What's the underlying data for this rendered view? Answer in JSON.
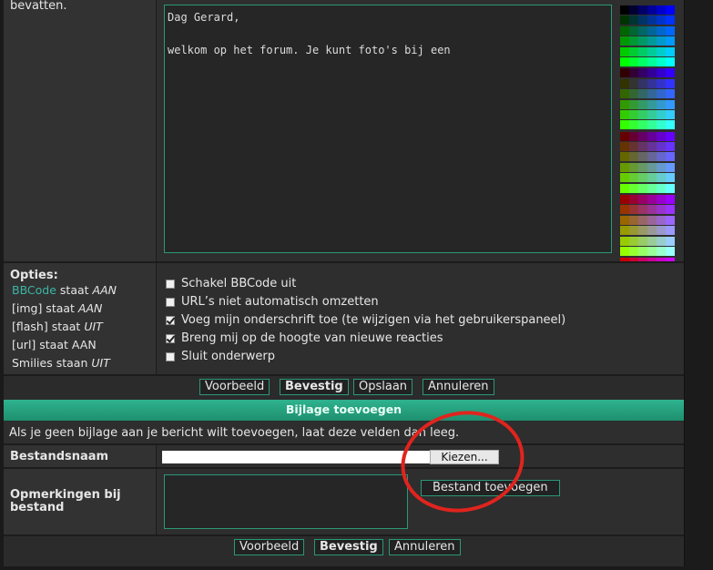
{
  "top_left_text": "bevatten.",
  "message": {
    "text": "Dag Gerard,\n\nwelkom op het forum. Je kunt foto's bij een"
  },
  "palette": {
    "rows": [
      [
        "#000000",
        "#000033",
        "#000066",
        "#000099",
        "#0000cc",
        "#0000ff"
      ],
      [
        "#003300",
        "#003333",
        "#003366",
        "#003399",
        "#0033cc",
        "#0033ff"
      ],
      [
        "#006600",
        "#006633",
        "#006666",
        "#006699",
        "#0066cc",
        "#0066ff"
      ],
      [
        "#009900",
        "#009933",
        "#009966",
        "#009999",
        "#0099cc",
        "#0099ff"
      ],
      [
        "#00cc00",
        "#00cc33",
        "#00cc66",
        "#00cc99",
        "#00cccc",
        "#00ccff"
      ],
      [
        "#00ff00",
        "#00ff33",
        "#00ff66",
        "#00ff99",
        "#00ffcc",
        "#00ffff"
      ],
      [
        "#330000",
        "#330033",
        "#330066",
        "#330099",
        "#3300cc",
        "#3300ff"
      ],
      [
        "#333300",
        "#333333",
        "#333366",
        "#333399",
        "#3333cc",
        "#3333ff"
      ],
      [
        "#336600",
        "#336633",
        "#336666",
        "#336699",
        "#3366cc",
        "#3366ff"
      ],
      [
        "#339900",
        "#339933",
        "#339966",
        "#339999",
        "#3399cc",
        "#3399ff"
      ],
      [
        "#33cc00",
        "#33cc33",
        "#33cc66",
        "#33cc99",
        "#33cccc",
        "#33ccff"
      ],
      [
        "#33ff00",
        "#33ff33",
        "#33ff66",
        "#33ff99",
        "#33ffcc",
        "#33ffff"
      ],
      [
        "#660000",
        "#660033",
        "#660066",
        "#660099",
        "#6600cc",
        "#6600ff"
      ],
      [
        "#663300",
        "#663333",
        "#663366",
        "#663399",
        "#6633cc",
        "#6633ff"
      ],
      [
        "#666600",
        "#666633",
        "#666666",
        "#666699",
        "#6666cc",
        "#6666ff"
      ],
      [
        "#669900",
        "#669933",
        "#669966",
        "#669999",
        "#6699cc",
        "#6699ff"
      ],
      [
        "#66cc00",
        "#66cc33",
        "#66cc66",
        "#66cc99",
        "#66cccc",
        "#66ccff"
      ],
      [
        "#66ff00",
        "#66ff33",
        "#66ff66",
        "#66ff99",
        "#66ffcc",
        "#66ffff"
      ],
      [
        "#990000",
        "#990033",
        "#990066",
        "#990099",
        "#9900cc",
        "#9900ff"
      ],
      [
        "#993300",
        "#993333",
        "#993366",
        "#993399",
        "#9933cc",
        "#9933ff"
      ],
      [
        "#996600",
        "#996633",
        "#996666",
        "#996699",
        "#9966cc",
        "#9966ff"
      ],
      [
        "#999900",
        "#999933",
        "#999966",
        "#999999",
        "#9999cc",
        "#9999ff"
      ],
      [
        "#99cc00",
        "#99cc33",
        "#99cc66",
        "#99cc99",
        "#99cccc",
        "#99ccff"
      ],
      [
        "#99ff00",
        "#99ff33",
        "#99ff66",
        "#99ff99",
        "#99ffcc",
        "#99ffff"
      ],
      [
        "#cc0000",
        "#cc0033",
        "#cc0066",
        "#cc0099",
        "#cc00cc",
        "#cc00ff"
      ],
      [
        "#cc3300",
        "#cc3333",
        "#cc3366",
        "#cc3399",
        "#cc33cc",
        "#cc33ff"
      ],
      [
        "#cc6600",
        "#cc6633",
        "#cc6666",
        "#cc6699",
        "#cc66cc",
        "#cc66ff"
      ],
      [
        "#cc9900",
        "#cc9933",
        "#cc9966",
        "#cc9999",
        "#cc99cc",
        "#cc99ff"
      ],
      [
        "#cccc00",
        "#cccc33",
        "#cccc66",
        "#cccc99",
        "#cccccc",
        "#ccccff"
      ],
      [
        "#ccff00",
        "#ccff33",
        "#ccff66",
        "#ccff99",
        "#ccffcc",
        "#ccffff"
      ],
      [
        "#ff0000",
        "#ff0033",
        "#ff0066",
        "#ff0099",
        "#ff00cc",
        "#ff00ff"
      ],
      [
        "#ff3300",
        "#ff3333",
        "#ff3366",
        "#ff3399",
        "#ff33cc",
        "#ff33ff"
      ],
      [
        "#ff6600",
        "#ff6633",
        "#ff6666",
        "#ff6699",
        "#ff66cc",
        "#ff66ff"
      ],
      [
        "#ff9900",
        "#ff9933",
        "#ff9966",
        "#ff9999",
        "#ff99cc",
        "#ff99ff"
      ],
      [
        "#ffcc00",
        "#ffcc33",
        "#ffcc66",
        "#ffcc99",
        "#ffcccc",
        "#ffccff"
      ],
      [
        "#ffff00",
        "#ffff33",
        "#ffff66",
        "#ffff99",
        "#ffffcc",
        "#ffffff"
      ]
    ]
  },
  "options": {
    "heading": "Opties:",
    "bbcode_link": "BBCode",
    "bbcode_rest": " staat ",
    "bbcode_state": "AAN",
    "img_prefix": "[img] staat ",
    "img_state": "AAN",
    "flash_prefix": "[flash] staat ",
    "flash_state": "UIT",
    "url_line": "[url] staat AAN",
    "smilies_prefix": "Smilies staan ",
    "smilies_state": "UIT"
  },
  "checkboxes": [
    {
      "label": "Schakel BBCode uit",
      "checked": false
    },
    {
      "label": "URL’s niet automatisch omzetten",
      "checked": false
    },
    {
      "label": "Voeg mijn onderschrift toe (te wijzigen via het gebruikerspaneel)",
      "checked": true
    },
    {
      "label": "Breng mij op de hoogte van nieuwe reacties",
      "checked": true
    },
    {
      "label": "Sluit onderwerp",
      "checked": false
    }
  ],
  "buttons_top": {
    "preview": "Voorbeeld",
    "submit": "Bevestig",
    "save": "Opslaan",
    "cancel": "Annuleren"
  },
  "attachment": {
    "header": "Bijlage toevoegen",
    "info": "Als je geen bijlage aan je bericht wilt toevoegen, laat deze velden dan leeg.",
    "filename_label": "Bestandsnaam",
    "choose_button": "Kiezen...",
    "comment_label": "Opmerkingen bij bestand",
    "add_button": "Bestand toevoegen"
  },
  "buttons_bottom": {
    "preview": "Voorbeeld",
    "submit": "Bevestig",
    "cancel": "Annuleren"
  },
  "annotation_color": "#e0241e"
}
